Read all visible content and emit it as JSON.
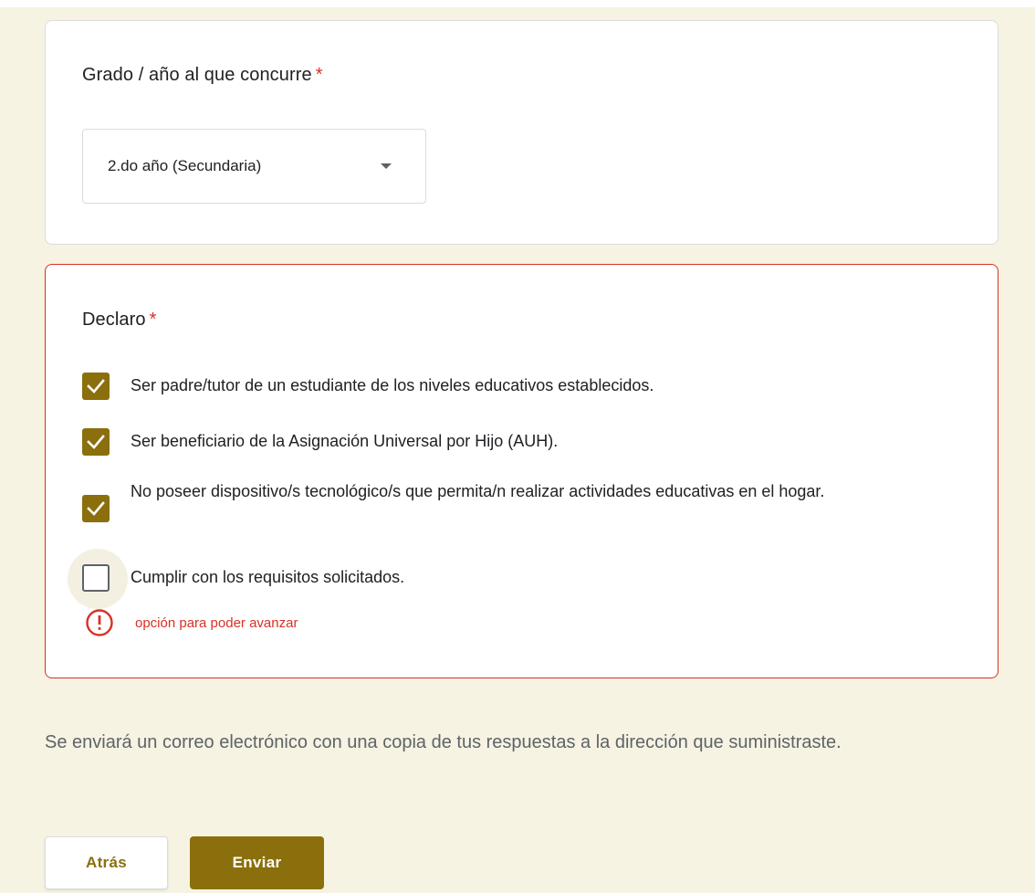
{
  "theme": {
    "accent": "#8a6f0c",
    "error": "#d93025",
    "background": "#f6f3e2"
  },
  "grado_question": {
    "title": "Grado / año al que concurre",
    "required_mark": "*",
    "selected_value": "2.do año (Secundaria)"
  },
  "declaro_question": {
    "title": "Declaro",
    "required_mark": "*",
    "options": [
      {
        "label": "Ser padre/tutor de un estudiante de los niveles educativos establecidos.",
        "checked": true
      },
      {
        "label": "Ser beneficiario de la Asignación Universal por Hijo (AUH).",
        "checked": true
      },
      {
        "label": "No poseer dispositivo/s tecnológico/s que permita/n realizar actividades educativas en el hogar.",
        "checked": true
      },
      {
        "label": "Cumplir con los requisitos solicitados.",
        "checked": false
      }
    ],
    "error_message": "opción para poder avanzar"
  },
  "email_note": "Se enviará un correo electrónico con una copia de tus respuestas a la dirección que suministraste.",
  "buttons": {
    "back_label": "Atrás",
    "submit_label": "Enviar"
  }
}
